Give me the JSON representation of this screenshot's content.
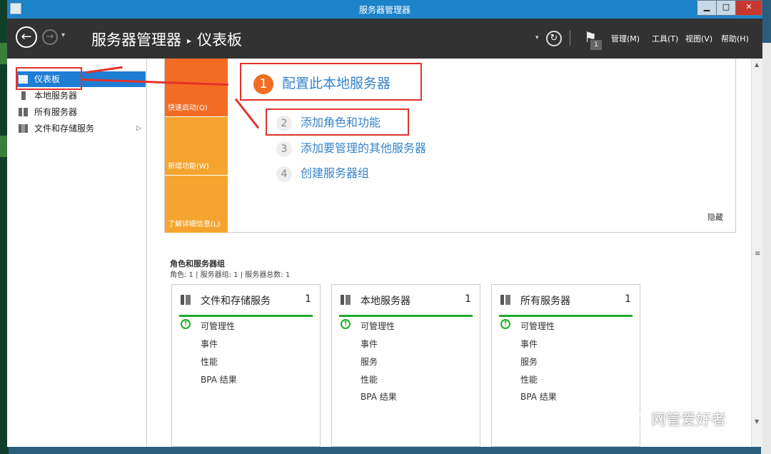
{
  "window": {
    "title": "服务器管理器",
    "min": "▁",
    "max": "□",
    "close": "✕"
  },
  "toolbar": {
    "back": "←",
    "forward": "→",
    "history": "▾",
    "breadcrumb_root": "服务器管理器",
    "breadcrumb_sep": "▸",
    "breadcrumb_page": "仪表板",
    "refresh": "↻",
    "notifications_count": "1",
    "menus": [
      "管理(M)",
      "工具(T)",
      "视图(V)",
      "帮助(H)"
    ]
  },
  "sidebar": {
    "items": [
      {
        "label": "仪表板",
        "icon": "dashboard-icon",
        "active": true
      },
      {
        "label": "本地服务器",
        "icon": "server-icon"
      },
      {
        "label": "所有服务器",
        "icon": "servers-icon"
      },
      {
        "label": "文件和存储服务",
        "icon": "storage-icon",
        "expand": "▷"
      }
    ]
  },
  "quickstart": {
    "tabs": [
      "快速启动(Q)",
      "新增功能(W)",
      "了解详细信息(L)"
    ],
    "steps": [
      {
        "num": "1",
        "label": "配置此本地服务器"
      },
      {
        "num": "2",
        "label": "添加角色和功能"
      },
      {
        "num": "3",
        "label": "添加要管理的其他服务器"
      },
      {
        "num": "4",
        "label": "创建服务器组"
      }
    ],
    "hide": "隐藏"
  },
  "groups": {
    "title": "角色和服务器组",
    "subtitle": "角色: 1 | 服务器组: 1 | 服务器总数: 1",
    "cards": [
      {
        "title": "文件和存储服务",
        "count": "1",
        "rows": [
          "可管理性",
          "事件",
          "性能",
          "BPA 结果"
        ]
      },
      {
        "title": "本地服务器",
        "count": "1",
        "rows": [
          "可管理性",
          "事件",
          "服务",
          "性能",
          "BPA 结果"
        ]
      },
      {
        "title": "所有服务器",
        "count": "1",
        "rows": [
          "可管理性",
          "事件",
          "服务",
          "性能",
          "BPA 结果"
        ]
      }
    ]
  },
  "watermark": "网管爱好者",
  "colors": {
    "accent": "#1e7ed4",
    "orange": "#f26c23",
    "amber": "#f5a52f",
    "green": "#1fab2a",
    "annotation": "#e2322b"
  }
}
